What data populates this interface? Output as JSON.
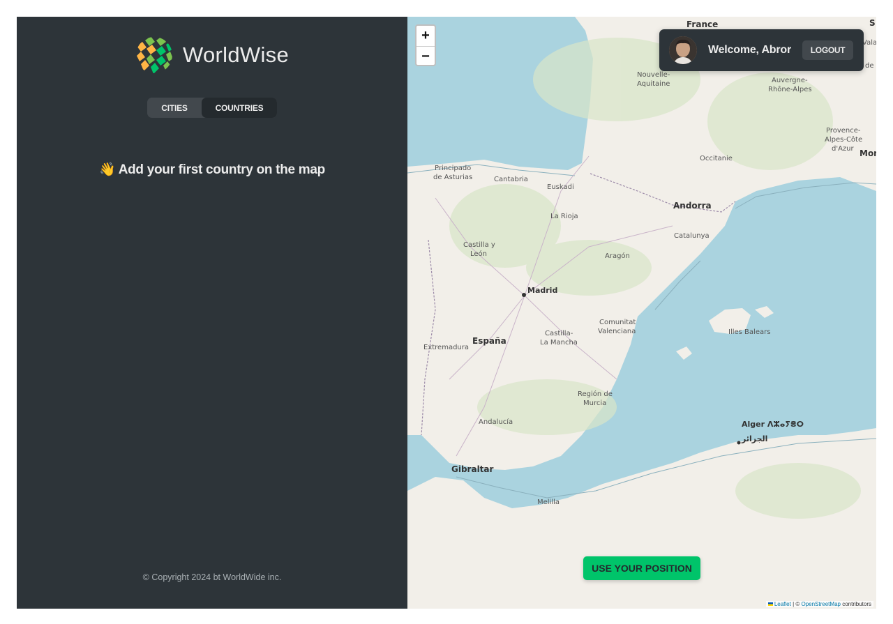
{
  "sidebar": {
    "logo_text": "WorldWise",
    "tabs": [
      {
        "label": "CITIES"
      },
      {
        "label": "COUNTRIES"
      }
    ],
    "empty_message": "👋 Add your first country on the map",
    "copyright": "© Copyright 2024 bt WorldWide inc."
  },
  "map": {
    "zoom_in": "+",
    "zoom_out": "−",
    "user": {
      "welcome": "Welcome, Abror",
      "logout_label": "LOGOUT"
    },
    "position_button": "USE YOUR POSITION",
    "attribution": {
      "leaflet": "Leaflet",
      "separator": " | © ",
      "osm": "OpenStreetMap",
      "contributors": " contributors"
    },
    "labels": {
      "france": "France",
      "nouvelle": "Nouvelle-",
      "aquitaine": "Aquitaine",
      "auvergne": "Auvergne-",
      "rhone": "Rhône-Alpes",
      "provence1": "Provence-",
      "provence2": "Alpes-Côte",
      "provence3": "d'Azur",
      "occitanie": "Occitanie",
      "mon": "Mon",
      "principado1": "Principado",
      "principado2": "de Asturias",
      "cantabria": "Cantabria",
      "euskadi": "Euskadi",
      "andorra": "Andorra",
      "larioja": "La Rioja",
      "catalunya": "Catalunya",
      "castilla1": "Castilla y",
      "castilla2": "León",
      "aragon": "Aragón",
      "madrid": "Madrid",
      "espana": "España",
      "extremadura": "Extremadura",
      "clm1": "Castilla-",
      "clm2": "La Mancha",
      "valencia1": "Comunitat",
      "valencia2": "Valenciana",
      "baleares": "Illes Balears",
      "murcia1": "Región de",
      "murcia2": "Murcia",
      "andalucia": "Andalucía",
      "alger": "Alger ⴷⵣⴰⵢⴻⵔ",
      "alger_ar": "الجزائر",
      "gibraltar": "Gibraltar",
      "melilla": "Melilla",
      "edge_s": "S",
      "edge_vala": "Vala",
      "edge_de": "de"
    }
  },
  "colors": {
    "sidebar_bg": "#2d3439",
    "sea": "#aad3df",
    "land": "#f2efe9",
    "accent_green": "#00c46a"
  }
}
